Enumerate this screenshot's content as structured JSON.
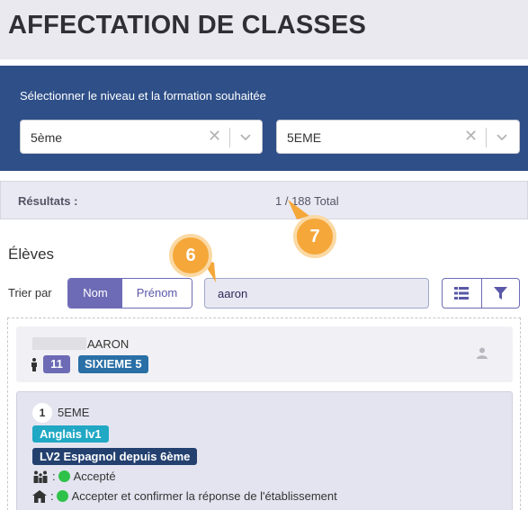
{
  "page": {
    "title": "AFFECTATION DE CLASSES"
  },
  "filters": {
    "label": "Sélectionner le niveau et la formation souhaitée",
    "level_select": {
      "value": "5ème"
    },
    "formation_select": {
      "value": "5EME"
    }
  },
  "results": {
    "label": "Résultats :",
    "count": "1 / 188 Total"
  },
  "callouts": {
    "search": "6",
    "results": "7"
  },
  "students_section": {
    "title": "Élèves",
    "sort": {
      "label": "Trier par",
      "options": [
        "Nom",
        "Prénom"
      ],
      "active": "Nom"
    },
    "search": {
      "value": "aaron"
    }
  },
  "student": {
    "name": "AARON",
    "age": "11",
    "class": "SIXIEME 5",
    "wish": {
      "rank": "1",
      "level": "5EME",
      "options": [
        "Anglais lv1",
        "LV2 Espagnol depuis 6ème"
      ],
      "statuses": [
        {
          "icon": "family-icon",
          "text": "Accepté"
        },
        {
          "icon": "school-icon",
          "text": "Accepter et confirmer la réponse de l'établissement"
        }
      ]
    }
  },
  "colors": {
    "header_bg": "#e9e9ef",
    "filter_bg": "#2e4f88",
    "accent": "#6d6bb5",
    "class_badge": "#2a6fa6",
    "option1": "#20a8c4",
    "option2": "#23406f",
    "status_green": "#2fc24a",
    "callout": "#f5a73a"
  }
}
